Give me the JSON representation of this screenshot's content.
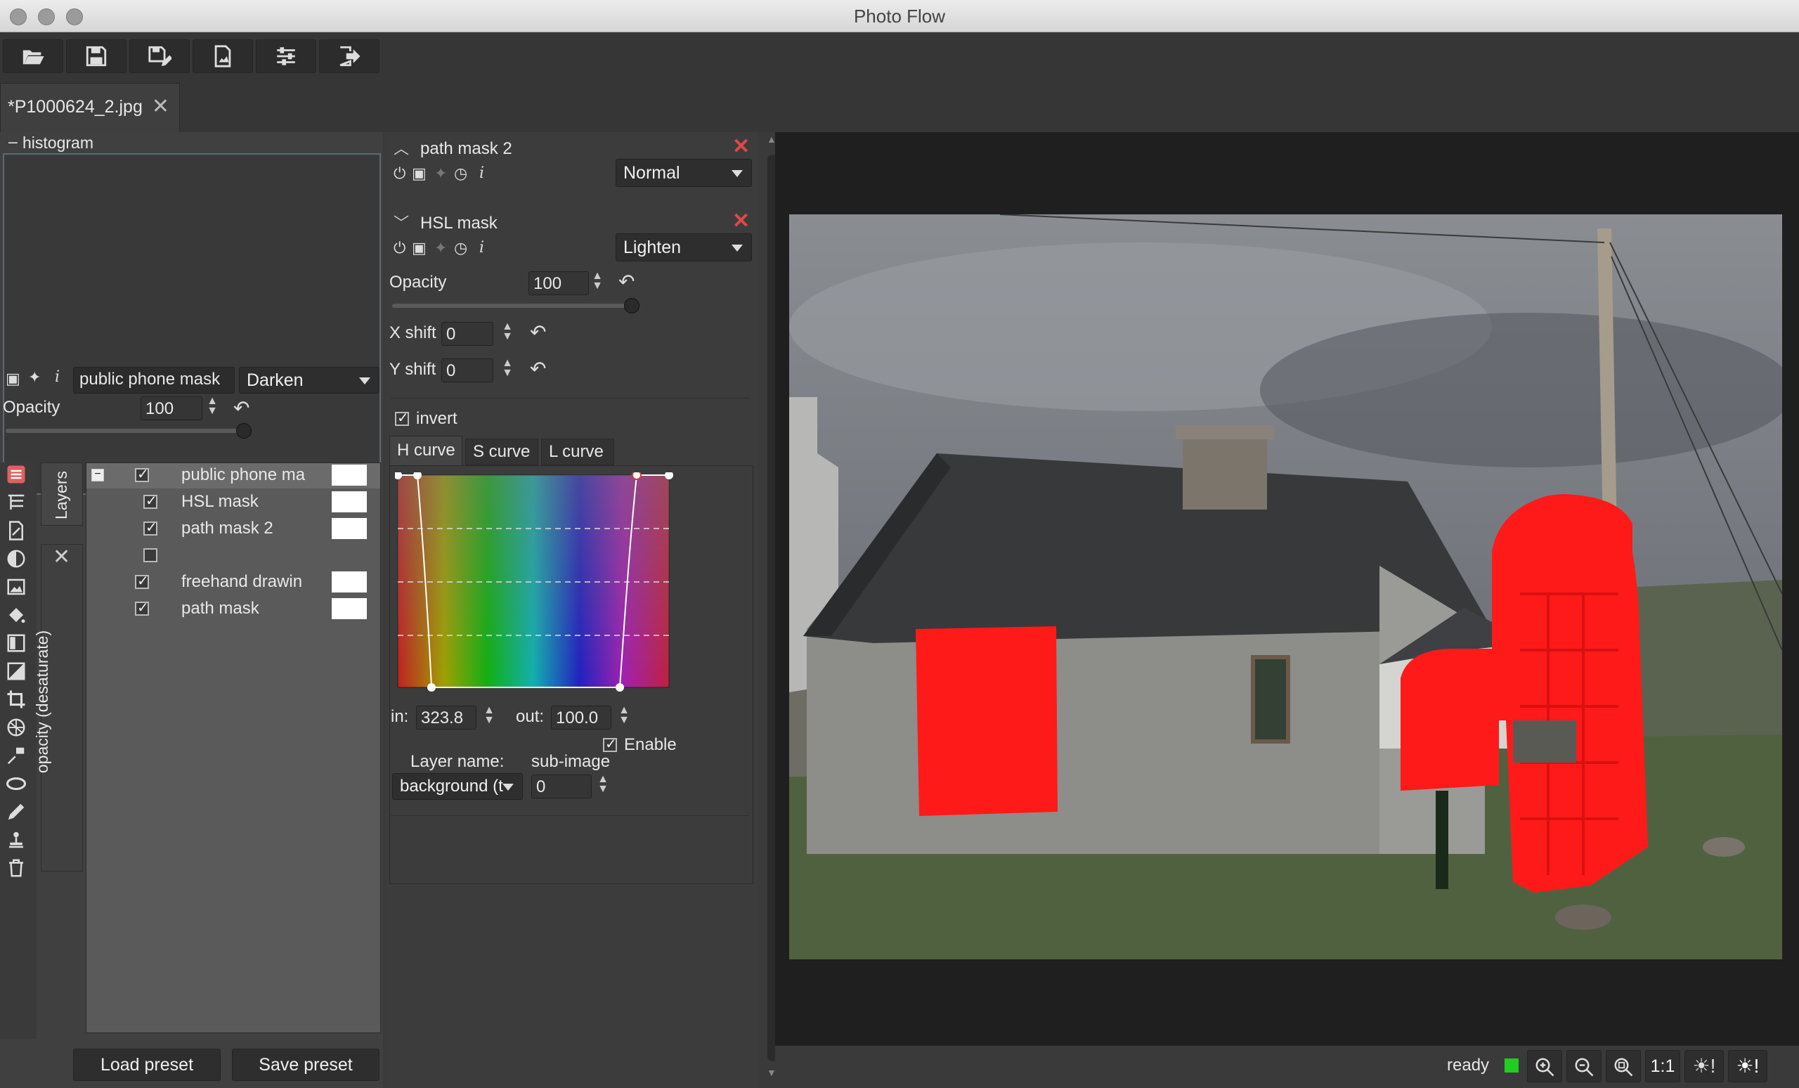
{
  "window": {
    "title": "Photo Flow"
  },
  "toolbar": {
    "buttons": [
      {
        "name": "open-icon"
      },
      {
        "name": "save-icon"
      },
      {
        "name": "save-as-icon"
      },
      {
        "name": "export-icon"
      },
      {
        "name": "settings-icon"
      },
      {
        "name": "exit-icon"
      }
    ]
  },
  "tab": {
    "filename": "*P1000624_2.jpg"
  },
  "histogram": {
    "label": "histogram",
    "toggle": "–"
  },
  "layer_props": {
    "name": "public phone mask",
    "blend": "Darken",
    "opacity_label": "Opacity",
    "opacity": "100",
    "opacity_fraction": 1.0
  },
  "side_tabs": {
    "layers": "Layers",
    "opacity": "opacity (desaturate)"
  },
  "layers": [
    {
      "label": "public phone ma",
      "checked": true,
      "expanded": true,
      "indent": 0,
      "swatch": true,
      "selected": true
    },
    {
      "label": "HSL mask",
      "checked": true,
      "indent": 1,
      "swatch": true
    },
    {
      "label": "path mask 2",
      "checked": true,
      "indent": 1,
      "swatch": true
    },
    {
      "label": "",
      "checked": false,
      "indent": 1,
      "swatch": false
    },
    {
      "label": "freehand drawin",
      "checked": true,
      "indent": 0,
      "swatch": true
    },
    {
      "label": "path mask",
      "checked": true,
      "indent": 0,
      "swatch": true
    }
  ],
  "presets": {
    "load": "Load preset",
    "save": "Save preset"
  },
  "module1": {
    "title": "path mask 2",
    "blend": "Normal"
  },
  "module2": {
    "title": "HSL mask",
    "blend": "Lighten",
    "opacity_label": "Opacity",
    "opacity": "100",
    "opacity_fraction": 1.0,
    "xshift_label": "X shift",
    "xshift": "0",
    "yshift_label": "Y shift",
    "yshift": "0",
    "invert_label": "invert",
    "invert": true,
    "curve_tabs": [
      "H curve",
      "S curve",
      "L curve"
    ],
    "active_curve_tab": "H curve",
    "in_label": "in:",
    "in_value": "323.8",
    "out_label": "out:",
    "out_value": "100.0",
    "enable_label": "Enable",
    "enable": true,
    "layer_name_label": "Layer name:",
    "subimage_label": "sub-image",
    "layer_name_value": "background (t",
    "subimage_value": "0"
  },
  "status": {
    "text": "ready",
    "indicator_color": "#22cc22",
    "zoom_buttons": [
      "zoom-in-icon",
      "zoom-out-icon",
      "zoom-fit-icon"
    ],
    "one_to_one": "1:1",
    "brightness_buttons": [
      "sun-warning-icon",
      "sun-warning-icon"
    ]
  },
  "colors": {
    "mask_red": "#ff1a1a",
    "background": "#1f1f1f"
  }
}
